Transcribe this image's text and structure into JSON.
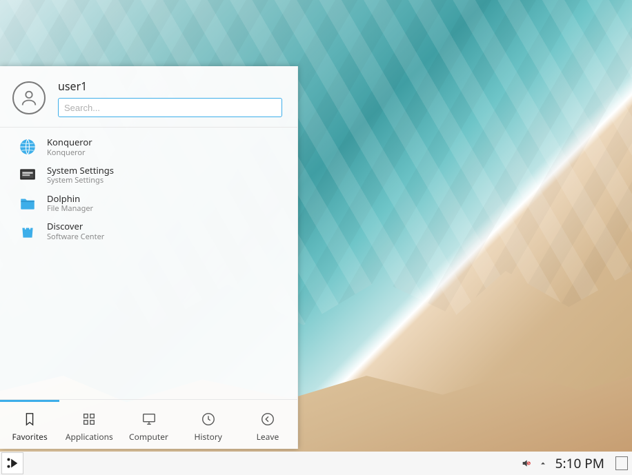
{
  "user": {
    "name": "user1"
  },
  "search": {
    "placeholder": "Search..."
  },
  "favorites": [
    {
      "title": "Konqueror",
      "subtitle": "Konqueror",
      "icon": "globe"
    },
    {
      "title": "System Settings",
      "subtitle": "System Settings",
      "icon": "settings-screen"
    },
    {
      "title": "Dolphin",
      "subtitle": "File Manager",
      "icon": "folder"
    },
    {
      "title": "Discover",
      "subtitle": "Software Center",
      "icon": "shopping-bag"
    }
  ],
  "tabs": [
    {
      "label": "Favorites",
      "icon": "bookmark",
      "active": true
    },
    {
      "label": "Applications",
      "icon": "grid",
      "active": false
    },
    {
      "label": "Computer",
      "icon": "monitor",
      "active": false
    },
    {
      "label": "History",
      "icon": "clock",
      "active": false
    },
    {
      "label": "Leave",
      "icon": "arrow-left",
      "active": false
    }
  ],
  "panel": {
    "clock": "5:10 PM",
    "tray": {
      "volume": "muted"
    }
  }
}
